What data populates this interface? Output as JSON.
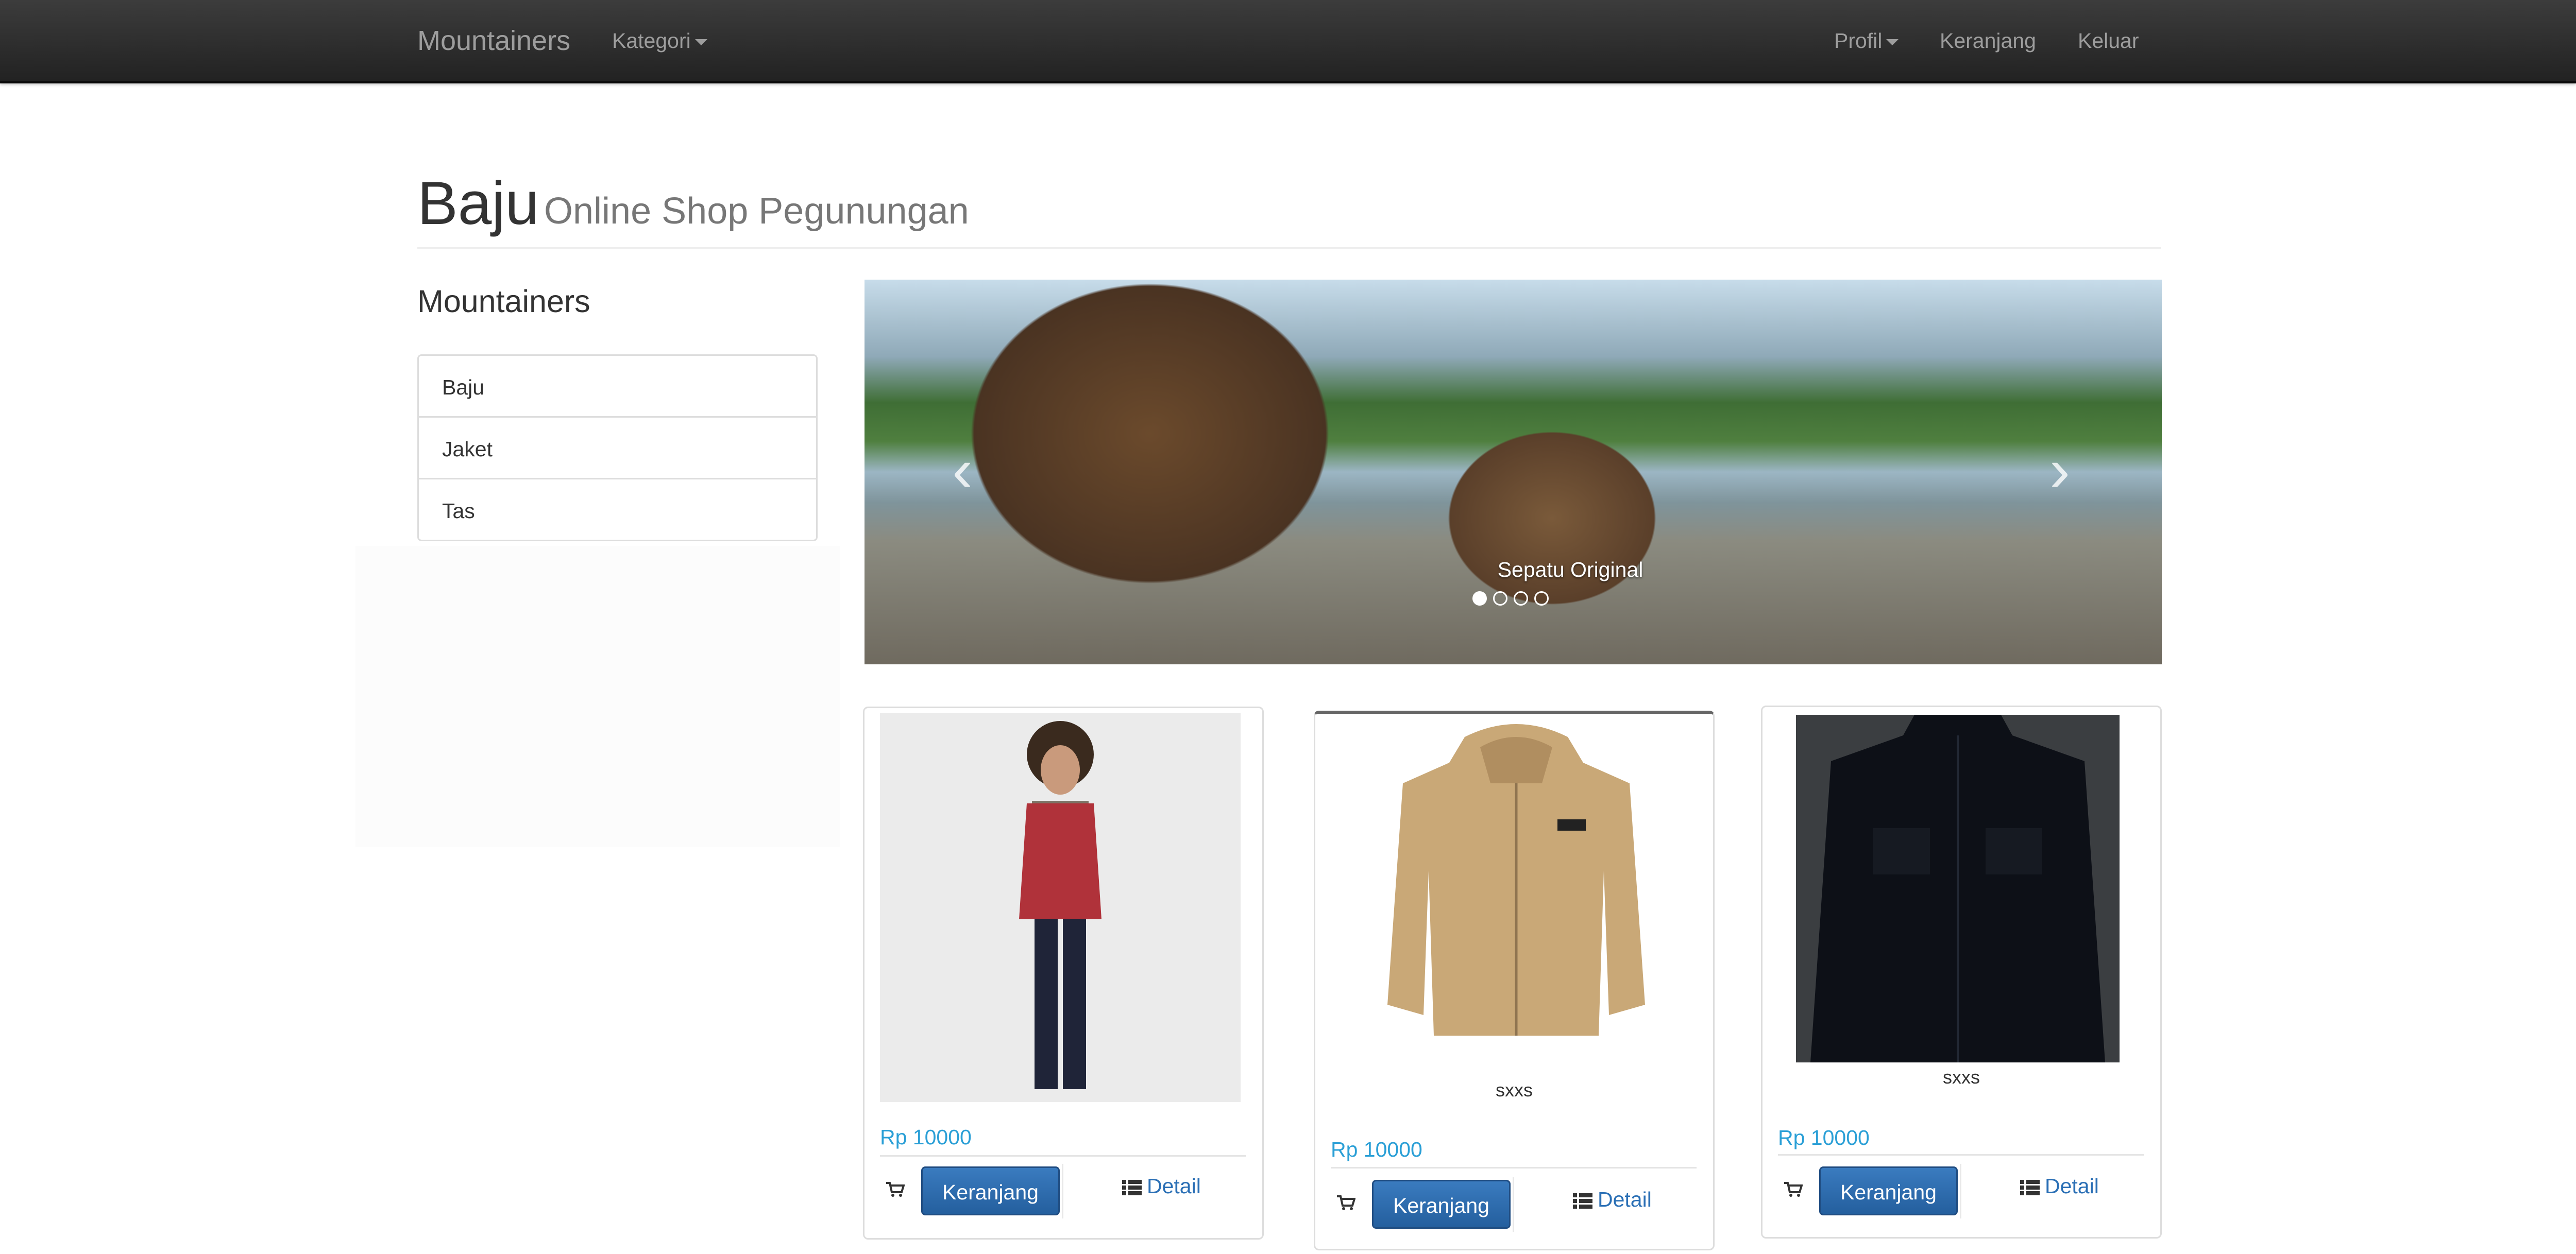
{
  "navbar": {
    "brand": "Mountainers",
    "kategori": "Kategori",
    "profil": "Profil",
    "keranjang": "Keranjang",
    "keluar": "Keluar"
  },
  "header": {
    "title": "Baju",
    "subtitle": "Online Shop Pegunungan"
  },
  "sidebar": {
    "title": "Mountainers",
    "items": [
      {
        "label": "Baju"
      },
      {
        "label": "Jaket"
      },
      {
        "label": "Tas"
      }
    ]
  },
  "carousel": {
    "caption": "Sepatu Original",
    "indicator_count": 4,
    "active_index": 0,
    "prev_glyph": "‹",
    "next_glyph": "›"
  },
  "products": [
    {
      "name": "",
      "price": "Rp 10000",
      "cart_label": "Keranjang",
      "detail_label": "Detail"
    },
    {
      "name": "sxxs",
      "price": "Rp 10000",
      "cart_label": "Keranjang",
      "detail_label": "Detail"
    },
    {
      "name": "sxxs",
      "price": "Rp 10000",
      "cart_label": "Keranjang",
      "detail_label": "Detail"
    }
  ],
  "colors": {
    "navbar_bg": "#222222",
    "link": "#2a9fd6",
    "primary_button": "#2d6ca8"
  }
}
